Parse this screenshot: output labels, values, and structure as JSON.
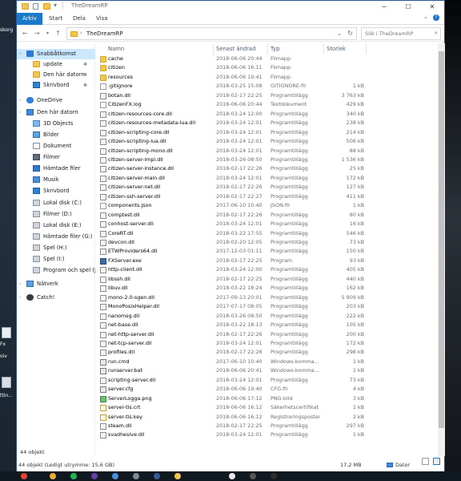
{
  "desktop_left": {
    "labels": [
      "skorg",
      "Fx",
      "oiv",
      "ttin..."
    ]
  },
  "window": {
    "title": "TheDreamRP",
    "ribbon_tabs": [
      {
        "label": "Arkiv",
        "active": true
      },
      {
        "label": "Start",
        "active": false
      },
      {
        "label": "Dela",
        "active": false
      },
      {
        "label": "Visa",
        "active": false
      }
    ],
    "address": {
      "path": "TheDreamRP",
      "prefix": "›"
    },
    "search": {
      "placeholder": "Sök i TheDreamRP"
    }
  },
  "nav_pane": {
    "items": [
      {
        "label": "Snabbåtkomst",
        "icon": "star-icon",
        "selected": true,
        "indent": 0,
        "pinned": false
      },
      {
        "label": "update",
        "icon": "folder-icon",
        "selected": false,
        "indent": 1,
        "pinned": true
      },
      {
        "label": "Den här datorn",
        "icon": "folder-icon",
        "selected": false,
        "indent": 1,
        "pinned": true
      },
      {
        "label": "Skrivbord",
        "icon": "desktop-icon",
        "selected": false,
        "indent": 1,
        "pinned": true
      },
      {
        "label": "OneDrive",
        "icon": "cloud-icon",
        "selected": false,
        "indent": 0,
        "pinned": false
      },
      {
        "label": "Den här datorn",
        "icon": "computer-icon",
        "selected": false,
        "indent": 0,
        "pinned": false
      },
      {
        "label": "3D Objects",
        "icon": "cube-icon",
        "selected": false,
        "indent": 1,
        "pinned": false
      },
      {
        "label": "Bilder",
        "icon": "pictures-icon",
        "selected": false,
        "indent": 1,
        "pinned": false
      },
      {
        "label": "Dokument",
        "icon": "documents-icon",
        "selected": false,
        "indent": 1,
        "pinned": false
      },
      {
        "label": "Filmer",
        "icon": "video-icon",
        "selected": false,
        "indent": 1,
        "pinned": false
      },
      {
        "label": "Hämtade filer",
        "icon": "download-icon",
        "selected": false,
        "indent": 1,
        "pinned": false
      },
      {
        "label": "Musik",
        "icon": "music-icon",
        "selected": false,
        "indent": 1,
        "pinned": false
      },
      {
        "label": "Skrivbord",
        "icon": "desktop-icon",
        "selected": false,
        "indent": 1,
        "pinned": false
      },
      {
        "label": "Lokal disk (C:)",
        "icon": "drive-icon",
        "selected": false,
        "indent": 1,
        "pinned": false
      },
      {
        "label": "Filmer (D:)",
        "icon": "drive-icon",
        "selected": false,
        "indent": 1,
        "pinned": false
      },
      {
        "label": "Lokal disk (E:)",
        "icon": "drive-icon",
        "selected": false,
        "indent": 1,
        "pinned": false
      },
      {
        "label": "Hämtade filer (G:)",
        "icon": "drive-icon",
        "selected": false,
        "indent": 1,
        "pinned": false
      },
      {
        "label": "Spel (H:)",
        "icon": "drive-icon",
        "selected": false,
        "indent": 1,
        "pinned": false
      },
      {
        "label": "Spel (I:)",
        "icon": "drive-icon",
        "selected": false,
        "indent": 1,
        "pinned": false
      },
      {
        "label": "Program och spel (J",
        "icon": "drive-icon",
        "selected": false,
        "indent": 1,
        "pinned": false
      },
      {
        "label": "Nätverk",
        "icon": "network-icon",
        "selected": false,
        "indent": 0,
        "pinned": false
      },
      {
        "label": "Catch!",
        "icon": "catch-icon",
        "selected": false,
        "indent": 0,
        "pinned": false
      }
    ]
  },
  "columns": {
    "name": "Namn",
    "date": "Senast ändrad",
    "type": "Typ",
    "size": "Storlek"
  },
  "files": [
    {
      "name": "cache",
      "date": "2018-06-06 20:44",
      "type": "Filmapp",
      "size": "",
      "icon": "folder-icon"
    },
    {
      "name": "citizen",
      "date": "2018-06-06 16:11",
      "type": "Filmapp",
      "size": "",
      "icon": "folder-icon"
    },
    {
      "name": "resources",
      "date": "2018-06-06 19:41",
      "type": "Filmapp",
      "size": "",
      "icon": "folder-icon"
    },
    {
      "name": ".gitignore",
      "date": "2018-03-25 15:08",
      "type": "GITIGNORE-fil",
      "size": "1 kB",
      "icon": "file-icon"
    },
    {
      "name": "botan.dll",
      "date": "2018-02-17 22:25",
      "type": "Programtillägg",
      "size": "3 763 kB",
      "icon": "dll-icon"
    },
    {
      "name": "CitizenFX.log",
      "date": "2018-06-06 20:44",
      "type": "Textdokument",
      "size": "429 kB",
      "icon": "file-icon"
    },
    {
      "name": "citizen-resources-core.dll",
      "date": "2018-03-24 12:00",
      "type": "Programtillägg",
      "size": "340 kB",
      "icon": "dll-icon"
    },
    {
      "name": "citizen-resources-metadata-lua.dll",
      "date": "2018-03-24 12:01",
      "type": "Programtillägg",
      "size": "238 kB",
      "icon": "dll-icon"
    },
    {
      "name": "citizen-scripting-core.dll",
      "date": "2018-03-24 12:01",
      "type": "Programtillägg",
      "size": "214 kB",
      "icon": "dll-icon"
    },
    {
      "name": "citizen-scripting-lua.dll",
      "date": "2018-03-24 12:01",
      "type": "Programtillägg",
      "size": "506 kB",
      "icon": "dll-icon"
    },
    {
      "name": "citizen-scripting-mono.dll",
      "date": "2018-03-24 12:01",
      "type": "Programtillägg",
      "size": "88 kB",
      "icon": "dll-icon"
    },
    {
      "name": "citizen-server-impl.dll",
      "date": "2018-03-26 08:50",
      "type": "Programtillägg",
      "size": "1 536 kB",
      "icon": "dll-icon"
    },
    {
      "name": "citizen-server-instance.dll",
      "date": "2018-02-17 22:26",
      "type": "Programtillägg",
      "size": "25 kB",
      "icon": "dll-icon"
    },
    {
      "name": "citizen-server-main.dll",
      "date": "2018-03-24 12:01",
      "type": "Programtillägg",
      "size": "172 kB",
      "icon": "dll-icon"
    },
    {
      "name": "citizen-server-net.dll",
      "date": "2018-02-17 22:26",
      "type": "Programtillägg",
      "size": "127 kB",
      "icon": "dll-icon"
    },
    {
      "name": "citizen-ssh-server.dll",
      "date": "2018-02-17 22:27",
      "type": "Programtillägg",
      "size": "411 kB",
      "icon": "dll-icon"
    },
    {
      "name": "components.json",
      "date": "2017-06-10 10:40",
      "type": "JSON-fil",
      "size": "1 kB",
      "icon": "file-icon"
    },
    {
      "name": "comptest.dll",
      "date": "2018-02-17 22:26",
      "type": "Programtillägg",
      "size": "80 kB",
      "icon": "dll-icon"
    },
    {
      "name": "conhost-server.dll",
      "date": "2018-03-24 12:01",
      "type": "Programtillägg",
      "size": "16 kB",
      "icon": "dll-icon"
    },
    {
      "name": "CoreRT.dll",
      "date": "2018-03-22 17:55",
      "type": "Programtillägg",
      "size": "546 kB",
      "icon": "dll-icon"
    },
    {
      "name": "devcon.dll",
      "date": "2018-02-20 12:05",
      "type": "Programtillägg",
      "size": "73 kB",
      "icon": "dll-icon"
    },
    {
      "name": "ETWProviders64.dll",
      "date": "2017-12-03 01:11",
      "type": "Programtillägg",
      "size": "150 kB",
      "icon": "dll-icon"
    },
    {
      "name": "FXServer.exe",
      "date": "2018-02-17 22:25",
      "type": "Program",
      "size": "93 kB",
      "icon": "exe-icon"
    },
    {
      "name": "http-client.dll",
      "date": "2018-03-24 12:00",
      "type": "Programtillägg",
      "size": "405 kB",
      "icon": "dll-icon"
    },
    {
      "name": "libssh.dll",
      "date": "2018-02-17 22:25",
      "type": "Programtillägg",
      "size": "440 kB",
      "icon": "dll-icon"
    },
    {
      "name": "libuv.dll",
      "date": "2018-03-22 18:24",
      "type": "Programtillägg",
      "size": "162 kB",
      "icon": "dll-icon"
    },
    {
      "name": "mono-2.0-sgen.dll",
      "date": "2017-09-13 20:01",
      "type": "Programtillägg",
      "size": "5 909 kB",
      "icon": "dll-icon"
    },
    {
      "name": "MonoPosixHelper.dll",
      "date": "2017-07-17 08:05",
      "type": "Programtillägg",
      "size": "203 kB",
      "icon": "dll-icon"
    },
    {
      "name": "nanomsg.dll",
      "date": "2018-03-26 08:50",
      "type": "Programtillägg",
      "size": "222 kB",
      "icon": "dll-icon"
    },
    {
      "name": "net-base.dll",
      "date": "2018-03-22 18:13",
      "type": "Programtillägg",
      "size": "105 kB",
      "icon": "dll-icon"
    },
    {
      "name": "net-http-server.dll",
      "date": "2018-02-17 22:26",
      "type": "Programtillägg",
      "size": "200 kB",
      "icon": "dll-icon"
    },
    {
      "name": "net-tcp-server.dll",
      "date": "2018-03-24 12:01",
      "type": "Programtillägg",
      "size": "172 kB",
      "icon": "dll-icon"
    },
    {
      "name": "profiles.dll",
      "date": "2018-02-17 22:26",
      "type": "Programtillägg",
      "size": "298 kB",
      "icon": "dll-icon"
    },
    {
      "name": "run.cmd",
      "date": "2017-06-10 10:40",
      "type": "Windows-komma...",
      "size": "1 kB",
      "icon": "cfg-icon"
    },
    {
      "name": "runserver.bat",
      "date": "2018-06-06 20:41",
      "type": "Windows-komma...",
      "size": "1 kB",
      "icon": "cfg-icon"
    },
    {
      "name": "scripting-server.dll",
      "date": "2018-03-24 12:01",
      "type": "Programtillägg",
      "size": "73 kB",
      "icon": "dll-icon"
    },
    {
      "name": "server.cfg",
      "date": "2018-06-06 19:40",
      "type": "CFG-fil",
      "size": "4 kB",
      "icon": "cfg-icon"
    },
    {
      "name": "ServerLogga.png",
      "date": "2018-06-06 17:12",
      "type": "PNG-bild",
      "size": "3 kB",
      "icon": "image-icon"
    },
    {
      "name": "server-tls.crt",
      "date": "2018-06-06 16:12",
      "type": "Säkerhetscertifikat",
      "size": "1 kB",
      "icon": "certificate-icon"
    },
    {
      "name": "server-tls.key",
      "date": "2018-06-06 16:12",
      "type": "Registreringsposter",
      "size": "2 kB",
      "icon": "key-icon"
    },
    {
      "name": "steam.dll",
      "date": "2018-02-17 22:25",
      "type": "Programtillägg",
      "size": "297 kB",
      "icon": "dll-icon"
    },
    {
      "name": "svadhesive.dll",
      "date": "2018-03-24 12:01",
      "type": "Programtillägg",
      "size": "1 kB",
      "icon": "dll-icon"
    }
  ],
  "status": {
    "item_count": "44 objekt",
    "bottom_left": "44 objekt (Ledigt utrymme: 15,6 GB)",
    "bottom_size": "17,2 MB",
    "bottom_location": "Dator"
  },
  "colors": {
    "accent": "#1979ca",
    "selection": "#cce8ff",
    "folder": "#f3c74f"
  }
}
